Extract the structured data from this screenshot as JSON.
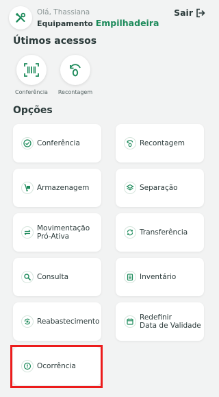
{
  "header": {
    "greeting": "Olá, Thassiana",
    "equipment_prefix": "Equipamento",
    "equipment_name": "Empilhadeira",
    "logout_label": "Sair"
  },
  "recent": {
    "title": "Útimos acessos",
    "items": [
      {
        "label": "Conferência",
        "icon": "barcode-scan-icon"
      },
      {
        "label": "Recontagem",
        "icon": "recount-icon"
      }
    ]
  },
  "options": {
    "title": "Opções",
    "items": [
      {
        "label": "Conferência",
        "icon": "check-circle-icon"
      },
      {
        "label": "Recontagem",
        "icon": "recount-icon"
      },
      {
        "label": "Armazenagem",
        "icon": "hand-truck-icon"
      },
      {
        "label": "Separação",
        "icon": "layers-icon"
      },
      {
        "label": "Movimentação\nPró-Ativa",
        "icon": "swap-arrows-icon"
      },
      {
        "label": "Transferência",
        "icon": "sync-icon"
      },
      {
        "label": "Consulta",
        "icon": "search-icon"
      },
      {
        "label": "Inventário",
        "icon": "clipboard-list-icon"
      },
      {
        "label": "Reabastecimento",
        "icon": "refill-icon"
      },
      {
        "label": "Redefinir\nData de Validade",
        "icon": "calendar-icon"
      },
      {
        "label": "Ocorrência",
        "icon": "alert-circle-icon"
      }
    ]
  },
  "colors": {
    "accent": "#1c8a5a",
    "background": "#f2f3f3",
    "card": "#ffffff",
    "text": "#2b3a3a",
    "highlight": "#ec1c1c"
  }
}
